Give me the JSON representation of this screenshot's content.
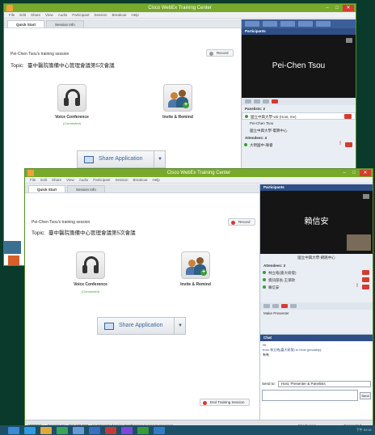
{
  "app": {
    "title": "Cisco WebEx Training Center"
  },
  "menu": [
    "File",
    "Edit",
    "Share",
    "View",
    "Audio",
    "Participant",
    "Session",
    "Breakout",
    "Help"
  ],
  "tabs": [
    "Quick Start",
    "Session Info"
  ],
  "win1": {
    "session_line": "Pei-Chen Tsou's training session",
    "topic_label": "Topic:",
    "topic_value": "臺中醫院籌備中心管理會議第5次會議",
    "record_label": "Record",
    "voice_label": "Voice Conference",
    "voice_status": "(Connected)",
    "invite_label": "Invite & Remind",
    "share_label": "Share Application",
    "participants_title": "Participants",
    "video_name": "Pei-Chen Tsou",
    "panelists_group": "Panelists: 2",
    "panelist_host": "國立中興大學-wb (Host, me)",
    "panelist_2": "Pei-Chen Tsou",
    "panelist_3": "國立中興大學-電算中心",
    "attendees_group": "Attendees: 4",
    "attendee_1": "大明國中-陳睿"
  },
  "win2": {
    "session_line": "Pei-Chen Tsou's training session",
    "topic_label": "Topic:",
    "topic_value": "臺中醫院籌備中心管理會議第5次會議",
    "record_label": "Record",
    "voice_label": "Voice Conference",
    "voice_status": "(Connected)",
    "invite_label": "Invite & Remind",
    "share_label": "Share Application",
    "end_session": "End Training Session",
    "participants_title": "Participants",
    "video_name": "賴信安",
    "video_caption": "國立中興大學-網路中心",
    "attendees_group": "Attendees: 3",
    "attendees": [
      "林立皓(嘉大研發)",
      "資訊部長-王澤政",
      "賴信安"
    ],
    "presenter_btn": "Make Presenter",
    "chat_title": "Chat",
    "chat_line1": "Hi",
    "chat_line2": "from 林立皓(嘉大研發) to Host (privately):",
    "chat_line3": "有有",
    "send_to_label": "Send to:",
    "send_to_value": "Host, Presenter & Panelists",
    "send_btn": "Send",
    "status_text": "Session No. 717 198 558 · An Integrated Voice Conference is now in progress",
    "status_brand": "WEBEX",
    "speak_label": "Speak now",
    "connected_label": "Connected"
  },
  "taskbar": {
    "clock": "下午 02:41"
  },
  "colors": {
    "title_green": "#78a92a",
    "panel_blue": "#2f4f86",
    "record_red": "#d33c2f"
  }
}
